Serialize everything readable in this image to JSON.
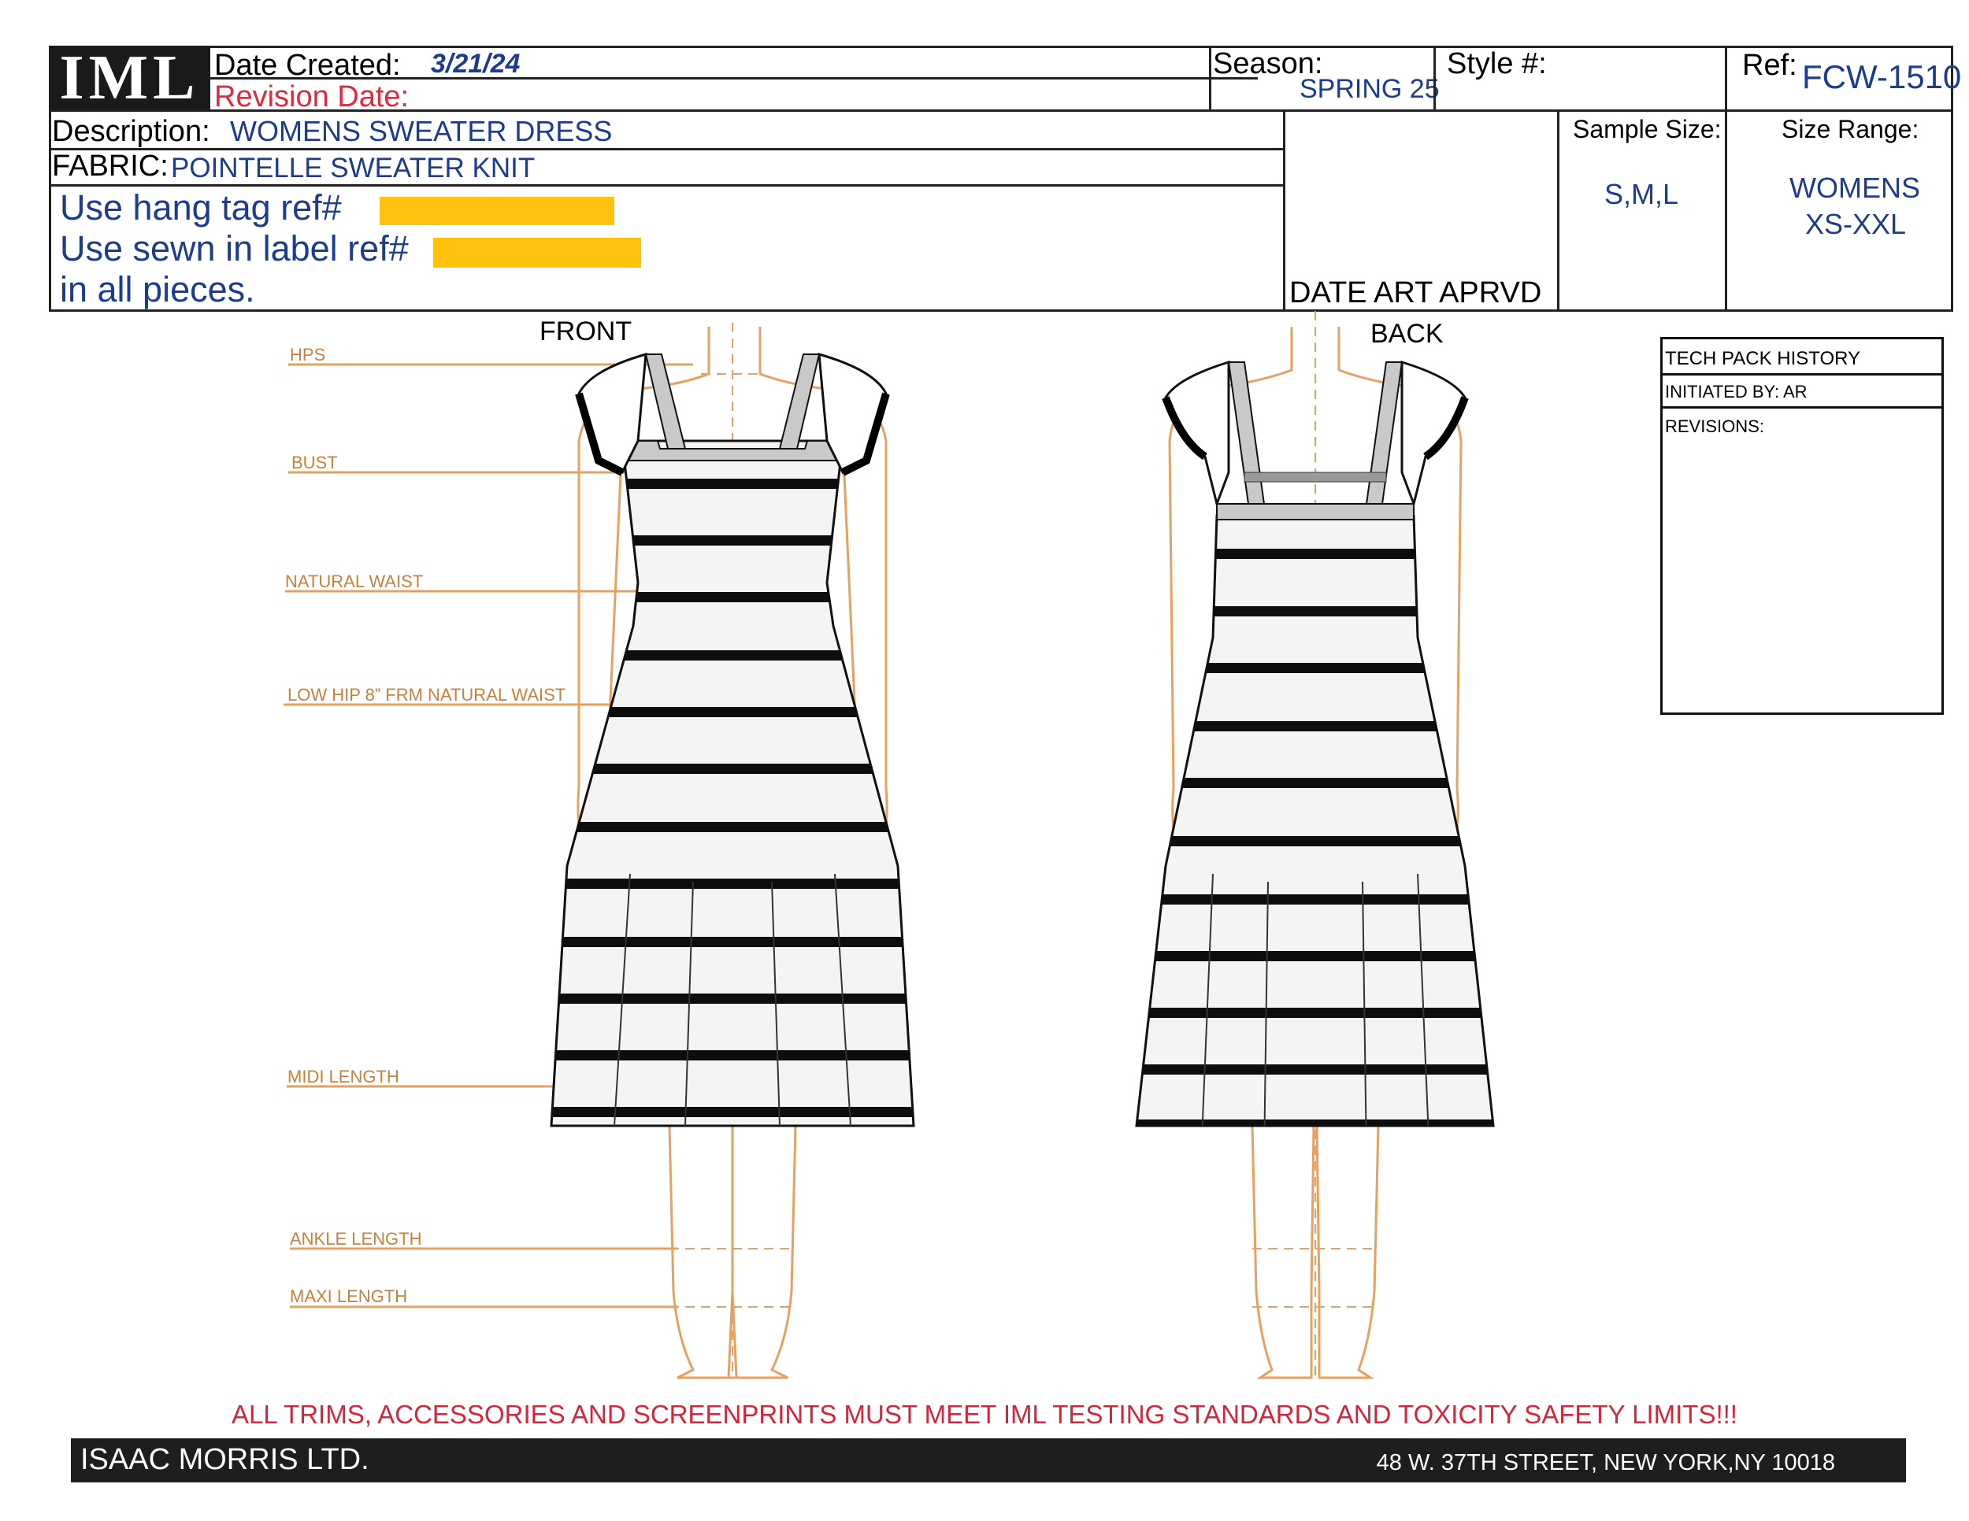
{
  "header": {
    "logo": "IML",
    "date_created_label": "Date Created:",
    "date_created": "3/21/24",
    "revision_date_label": "Revision Date:",
    "season_label": "Season:",
    "season": "SPRING 25",
    "style_label": "Style #:",
    "style_value": "",
    "ref_label": "Ref:",
    "ref": "FCW-1510",
    "description_label": "Description:",
    "description": "WOMENS SWEATER DRESS",
    "fabric_label": "FABRIC:",
    "fabric": "POINTELLE SWEATER KNIT",
    "hang_tag": "Use hang tag ref#",
    "sewn_label": "Use sewn in label ref#",
    "all_pieces": "in all pieces.",
    "date_art": "DATE ART APRVD",
    "sample_size_label": "Sample Size:",
    "sample_size": "S,M,L",
    "size_range_label": "Size Range:",
    "size_range_1": "WOMENS",
    "size_range_2": "XS-XXL"
  },
  "views": {
    "front": "FRONT",
    "back": "BACK"
  },
  "measurements": [
    "HPS",
    "BUST",
    "NATURAL WAIST",
    "LOW HIP 8” FRM  NATURAL WAIST",
    "MIDI LENGTH",
    "ANKLE  LENGTH",
    "MAXI LENGTH"
  ],
  "history": {
    "title": "TECH PACK HISTORY",
    "initiated": "INITIATED BY:  AR",
    "revisions": "REVISIONS:"
  },
  "warning": "ALL TRIMS, ACCESSORIES AND SCREENPRINTS MUST MEET IML TESTING STANDARDS AND TOXICITY SAFETY LIMITS!!!",
  "footer": {
    "company": "ISAAC MORRIS LTD.",
    "address": "48 W. 37TH STREET, NEW YORK,NY 10018"
  },
  "colors": {
    "label_blue": "#1d3b8f",
    "revision_red": "#e2283c",
    "redaction": "#ffc20e",
    "croquis": "#e8a060",
    "measure": "#c8803a",
    "warning_red": "#d6243a",
    "footer": "#1e1e1e"
  }
}
